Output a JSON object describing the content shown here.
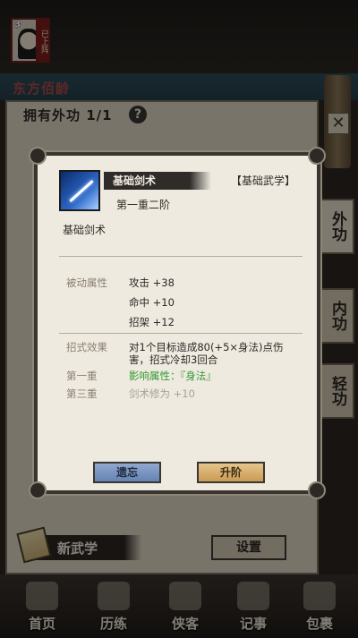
{
  "hero": {
    "level": "3",
    "status_tag": "已上阵",
    "name": "东方佰龄"
  },
  "panel": {
    "owned_title": "拥有外功",
    "owned_count": "1/1",
    "help_symbol": "?",
    "close_symbol": "✕"
  },
  "side_tabs": [
    {
      "label": "外功",
      "active": true
    },
    {
      "label": "内功",
      "active": false
    },
    {
      "label": "轻功",
      "active": false
    }
  ],
  "modal": {
    "skill_name": "基础剑术",
    "category": "【基础武学】",
    "rank": "第一重二阶",
    "caption": "基础剑术",
    "passive_label": "被动属性",
    "passives": [
      "攻击 +38",
      "命中 +10",
      "招架 +12"
    ],
    "effect_label": "招式效果",
    "effect_text_line1": "对1个目标造成80(+5×身法)点伤",
    "effect_text_line2": "害，招式冷却3回合",
    "tier1_label": "第一重",
    "tier1_text": "影响属性：『身法』",
    "tier3_label": "第三重",
    "tier3_text": "剑术修为 +10",
    "forget_button": "遗忘",
    "upgrade_button": "升阶"
  },
  "bottom": {
    "new_skill": "新武学",
    "settings": "设置"
  },
  "nav": [
    "首页",
    "历练",
    "侠客",
    "记事",
    "包裹"
  ],
  "colors": {
    "accent_green": "#2f9a2f",
    "forget_blue": "#6483b3",
    "upgrade_gold": "#c99a55"
  }
}
